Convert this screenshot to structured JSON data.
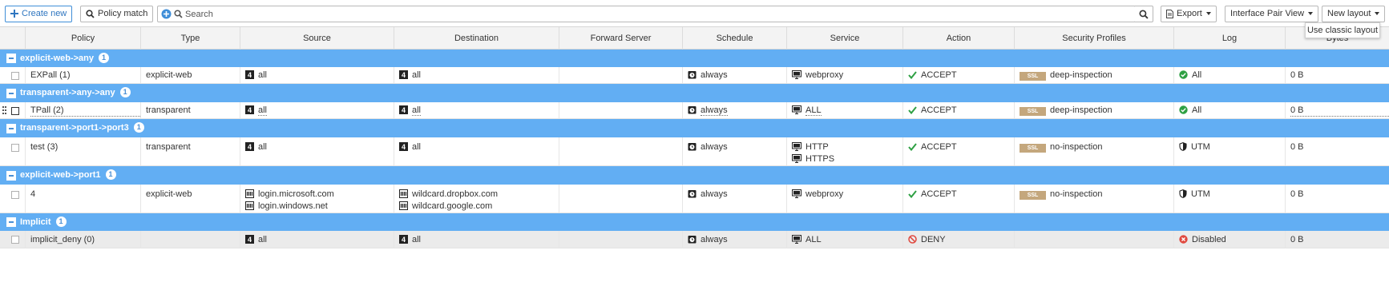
{
  "toolbar": {
    "create_new": "Create new",
    "policy_match": "Policy match",
    "search_placeholder": "Search",
    "export": "Export",
    "interface_pair_view": "Interface Pair View",
    "new_layout": "New layout",
    "tooltip": "Use classic layout"
  },
  "columns": [
    "Policy",
    "Type",
    "Source",
    "Destination",
    "Forward Server",
    "Schedule",
    "Service",
    "Action",
    "Security Profiles",
    "Log",
    "Bytes"
  ],
  "sections": [
    {
      "name": "explicit-web->any",
      "count": "1",
      "rows": [
        {
          "policy": "EXPall (1)",
          "type": "explicit-web",
          "source": [
            "all"
          ],
          "destination": [
            "all"
          ],
          "forward_server": "",
          "schedule": "always",
          "service": [
            "webproxy"
          ],
          "action": "ACCEPT",
          "profile": "deep-inspection",
          "log": "All",
          "bytes": "0 B"
        }
      ]
    },
    {
      "name": "transparent->any->any",
      "count": "1",
      "rows": [
        {
          "policy": "TPall (2)",
          "type": "transparent",
          "source": [
            "all"
          ],
          "destination": [
            "all"
          ],
          "forward_server": "",
          "schedule": "always",
          "service": [
            "ALL"
          ],
          "action": "ACCEPT",
          "profile": "deep-inspection",
          "log": "All",
          "bytes": "0 B"
        }
      ]
    },
    {
      "name": "transparent->port1->port3",
      "count": "1",
      "rows": [
        {
          "policy": "test (3)",
          "type": "transparent",
          "source": [
            "all"
          ],
          "destination": [
            "all"
          ],
          "forward_server": "",
          "schedule": "always",
          "service": [
            "HTTP",
            "HTTPS"
          ],
          "action": "ACCEPT",
          "profile": "no-inspection",
          "log": "UTM",
          "bytes": "0 B"
        }
      ]
    },
    {
      "name": "explicit-web->port1",
      "count": "1",
      "rows": [
        {
          "policy": "4",
          "type": "explicit-web",
          "source": [
            "login.microsoft.com",
            "login.windows.net"
          ],
          "destination": [
            "wildcard.dropbox.com",
            "wildcard.google.com"
          ],
          "forward_server": "",
          "schedule": "always",
          "service": [
            "webproxy"
          ],
          "action": "ACCEPT",
          "profile": "no-inspection",
          "log": "UTM",
          "bytes": "0 B"
        }
      ]
    },
    {
      "name": "Implicit",
      "count": "1",
      "rows": [
        {
          "policy": "implicit_deny (0)",
          "type": "",
          "source": [
            "all"
          ],
          "destination": [
            "all"
          ],
          "forward_server": "",
          "schedule": "always",
          "service": [
            "ALL"
          ],
          "action": "DENY",
          "profile": "",
          "log": "Disabled",
          "bytes": "0 B"
        }
      ]
    }
  ],
  "ssl_badge": "SSL",
  "colors": {
    "section_bar": "#62aef3",
    "accept": "#2ea043",
    "deny": "#e0493f",
    "ssl_badge": "#c4a77d",
    "primary": "#3f8ed8"
  }
}
